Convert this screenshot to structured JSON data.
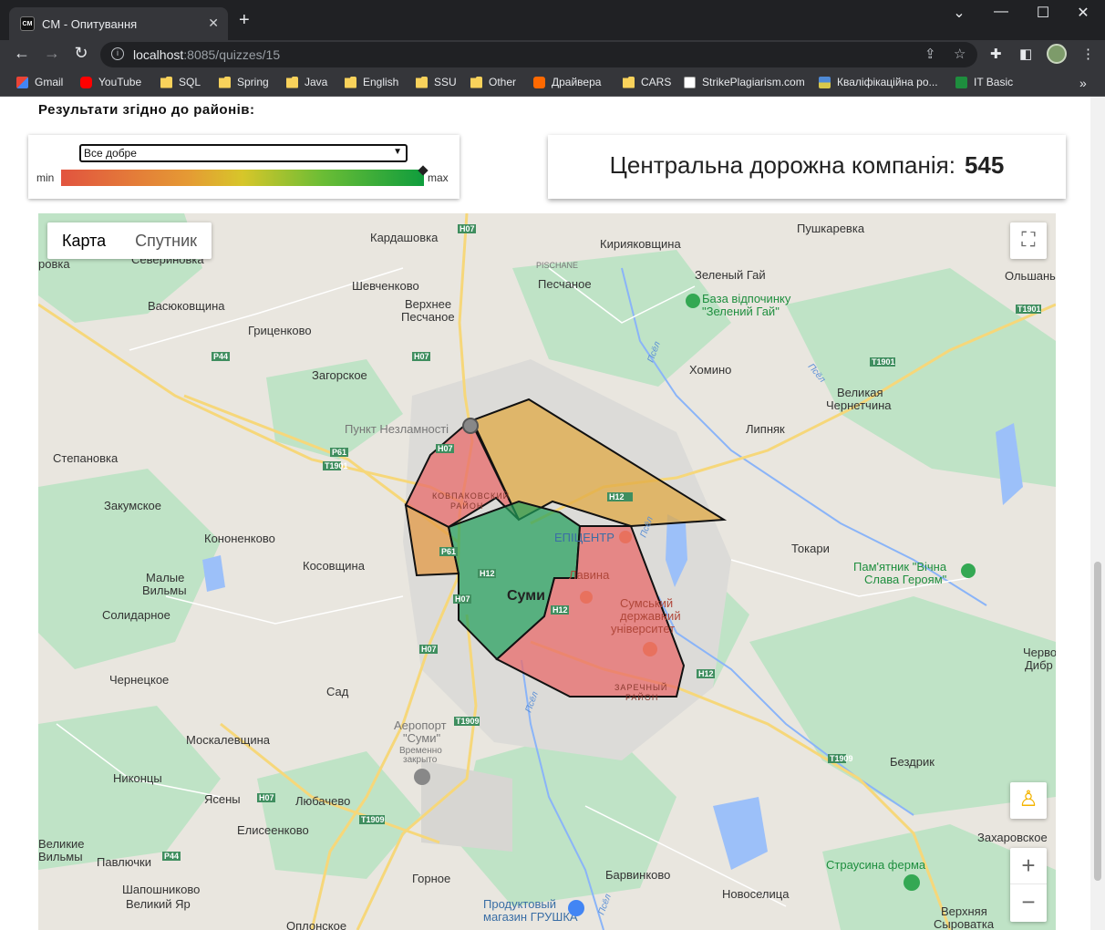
{
  "browser": {
    "tab_title": "CM - Опитування",
    "favicon_text": "CM",
    "url_host": "localhost",
    "url_path": ":8085/quizzes/15",
    "bookmarks": [
      "Gmail",
      "YouTube",
      "SQL",
      "Spring",
      "Java",
      "English",
      "SSU",
      "Other",
      "Драйвера",
      "CARS",
      "StrikePlagiarism.com",
      "Кваліфікаційна ро...",
      "IT Basic"
    ]
  },
  "page": {
    "section_title": "Результати згідно до районів:",
    "filter": {
      "selected": "Все добре",
      "legend_min": "min",
      "legend_max": "max"
    },
    "company": {
      "label": "Центральна дорожна компанія:",
      "count": "545"
    }
  },
  "map": {
    "type_controls": [
      "Карта",
      "Спутник"
    ],
    "zoom_in": "+",
    "zoom_out": "−",
    "colors": {
      "green": "#1e9e5a",
      "orange": "#e39a45",
      "red": "#e86b6b",
      "amber": "#e0a946"
    },
    "places": [
      "Кардашовка",
      "Кирияковщина",
      "Пушкаревка",
      "Севериновка",
      "ровка",
      "Васюковщина",
      "Шевченково",
      "Верхнее",
      "Песчаное",
      "Песчаное",
      "Зеленый Гай",
      "Ольшаны",
      "Гриценково",
      "Загорское",
      "Хомино",
      "Великая",
      "Чернетчина",
      "Липняк",
      "Пункт Незламності",
      "Степановка",
      "Закумское",
      "Кононенково",
      "Косовщина",
      "Малые",
      "Вильмы",
      "Солидарное",
      "Чернецкое",
      "Сад",
      "Москалевщина",
      "Никонцы",
      "Ясены",
      "Любачево",
      "Елисеенково",
      "Великие",
      "Вильмы",
      "Павлючки",
      "Шапошниково",
      "Великий Яр",
      "Горное",
      "Барвинково",
      "Новоселица",
      "Бездрик",
      "Захаровское",
      "Верхняя",
      "Сыроватка",
      "Токари",
      "Оплонское",
      "Червоне",
      "Дибр",
      "Суми",
      "PISCHANE"
    ],
    "pois": [
      "База відпочинку",
      "\"Зелений Гай\"",
      "Пам'ятник \"Вічна",
      "Слава Героям\"",
      "ЕПІЦЕНТР",
      "Лавина",
      "Сумський",
      "державний",
      "університет",
      "Аеропорт",
      "\"Суми\"",
      "Временно",
      "закрыто",
      "Страусина ферма",
      "Продуктовый",
      "магазин ГРУШКА"
    ],
    "districts": [
      "КОВПАКОВСКИЙ",
      "РАЙОН",
      "ЗАРЕЧНЫЙ",
      "РАЙОН"
    ],
    "road_tags": [
      "H07",
      "H07",
      "H07",
      "H07",
      "H07",
      "H07",
      "P44",
      "P44",
      "P61",
      "T1901",
      "T1901",
      "T1901",
      "H12",
      "H12",
      "H12",
      "H12",
      "T1909",
      "T1909",
      "P61",
      "T1909"
    ],
    "rivers": [
      "Псёл",
      "Псёл",
      "Псёл",
      "Псёл",
      "Псёл"
    ]
  }
}
